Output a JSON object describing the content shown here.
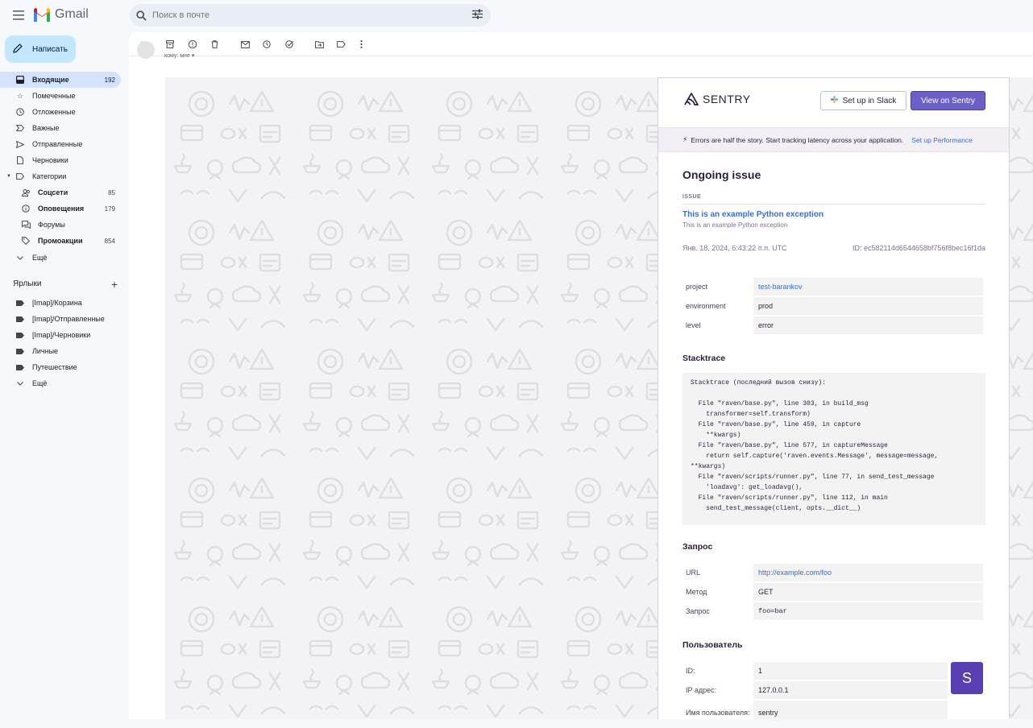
{
  "app": {
    "name": "Gmail"
  },
  "search": {
    "placeholder": "Поиск в почте"
  },
  "compose": {
    "label": "Написать"
  },
  "nav": [
    {
      "label": "Входящие",
      "count": "192",
      "icon": "inbox-icon",
      "active": true
    },
    {
      "label": "Помеченные",
      "count": "",
      "icon": "star-icon"
    },
    {
      "label": "Отложенные",
      "count": "",
      "icon": "clock-icon"
    },
    {
      "label": "Важные",
      "count": "",
      "icon": "important-icon"
    },
    {
      "label": "Отправленные",
      "count": "",
      "icon": "send-icon"
    },
    {
      "label": "Черновики",
      "count": "",
      "icon": "draft-icon"
    },
    {
      "label": "Категории",
      "count": "",
      "icon": "label-icon"
    }
  ],
  "categories": [
    {
      "label": "Соцсети",
      "count": "85",
      "icon": "people-icon",
      "bold": true
    },
    {
      "label": "Оповещения",
      "count": "179",
      "icon": "info-icon",
      "bold": true
    },
    {
      "label": "Форумы",
      "count": "",
      "icon": "forum-icon",
      "bold": false
    },
    {
      "label": "Промоакции",
      "count": "854",
      "icon": "tag-icon",
      "bold": true
    }
  ],
  "more1": "Ещё",
  "labels_title": "Ярлыки",
  "labels": [
    "[Imap]/Корзина",
    "[Imap]/Отправленные",
    "[Imap]/Черновики",
    "Личные",
    "Путешествие"
  ],
  "more2": "Ещё",
  "message": {
    "recipient": "кому: мне"
  },
  "sentry": {
    "logo_text": "SENTRY",
    "slack_button": "Set up in Slack",
    "view_button": "View on Sentry",
    "banner_text": "Errors are half the story. Start tracking latency across your application.",
    "banner_link": "Set up Performance",
    "heading": "Ongoing issue",
    "issue_label": "ISSUE",
    "issue_title": "This is an example Python exception",
    "issue_subtitle": "This is an example Python exception",
    "date": "Янв. 18, 2024, 6:43:22 п.п. UTC",
    "event_id": "ID: ec582114d6544658bf756f8bec16f1da",
    "tags": [
      {
        "key": "project",
        "value": "test-barankov",
        "link": true
      },
      {
        "key": "environment",
        "value": "prod",
        "link": false
      },
      {
        "key": "level",
        "value": "error",
        "link": false
      }
    ],
    "stacktrace_title": "Stacktrace",
    "stacktrace": "Stacktrace (последний вызов снизу):\n\n  File \"raven/base.py\", line 303, in build_msg\n    transformer=self.transform)\n  File \"raven/base.py\", line 459, in capture\n    **kwargs)\n  File \"raven/base.py\", line 577, in captureMessage\n    return self.capture('raven.events.Message', message=message,\n**kwargs)\n  File \"raven/scripts/runner.py\", line 77, in send_test_message\n    'loadavg': get_loadavg(),\n  File \"raven/scripts/runner.py\", line 112, in main\n    send_test_message(client, opts.__dict__)",
    "request_title": "Запрос",
    "request": [
      {
        "key": "URL",
        "value": "http://example.com/foo",
        "link": true,
        "mono": false
      },
      {
        "key": "Метод",
        "value": "GET",
        "link": false,
        "mono": false
      },
      {
        "key": "Запрос",
        "value": "foo=bar",
        "link": false,
        "mono": true
      }
    ],
    "user_title": "Пользователь",
    "user": [
      {
        "key": "ID:",
        "value": "1"
      },
      {
        "key": "IP адрес:",
        "value": "127.0.0.1"
      },
      {
        "key": "Имя пользователя:",
        "value": "sentry"
      }
    ],
    "user_avatar": "S",
    "accent": "#6c5fc7"
  }
}
